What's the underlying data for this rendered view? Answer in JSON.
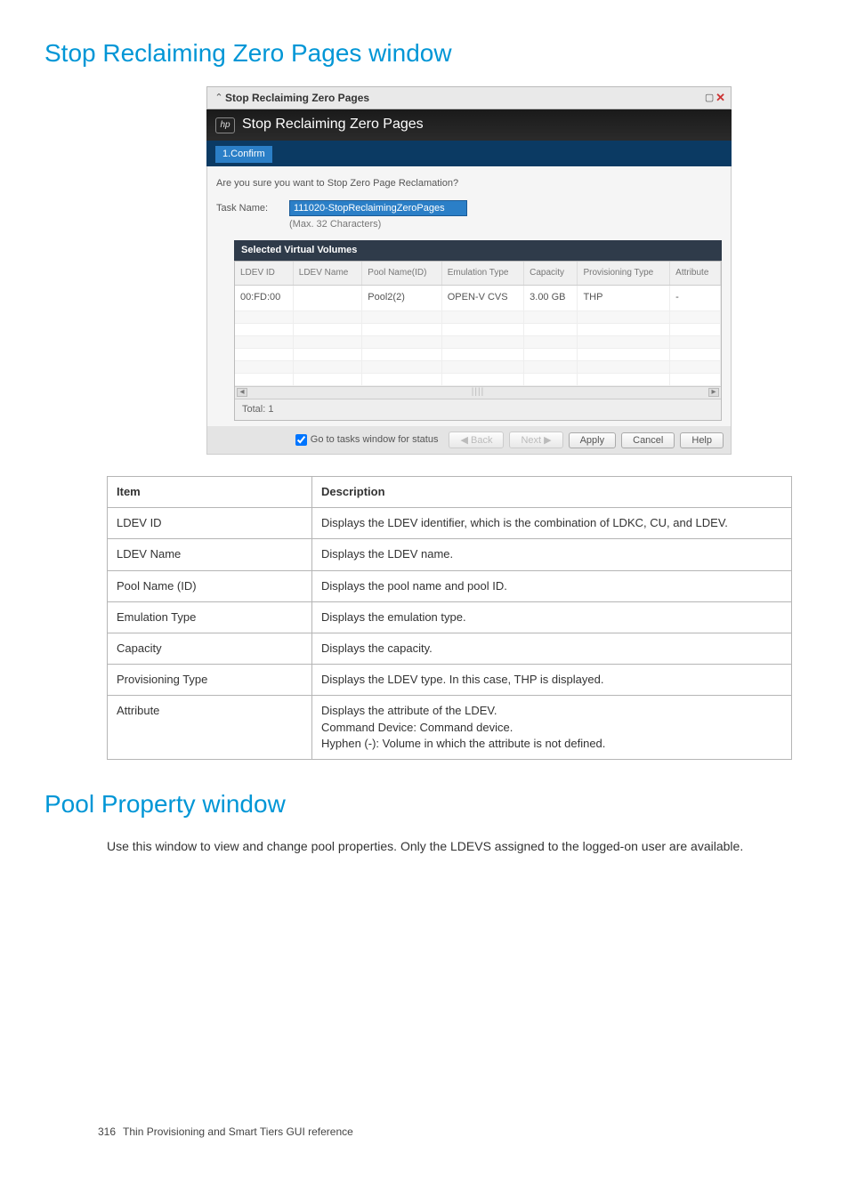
{
  "headings": {
    "main1": "Stop Reclaiming Zero Pages window",
    "main2": "Pool Property window"
  },
  "dialog": {
    "window_title": "Stop Reclaiming Zero Pages",
    "header_title": "Stop Reclaiming Zero Pages",
    "step_label": "1.Confirm",
    "confirm_question": "Are you sure you want to Stop Zero Page Reclamation?",
    "task_label": "Task Name:",
    "task_value": "111020-StopReclaimingZeroPages",
    "task_hint": "(Max. 32 Characters)",
    "panel_title": "Selected Virtual Volumes",
    "columns": {
      "ldev_id": "LDEV ID",
      "ldev_name": "LDEV Name",
      "pool": "Pool Name(ID)",
      "emulation": "Emulation Type",
      "capacity": "Capacity",
      "prov": "Provisioning Type",
      "attr": "Attribute"
    },
    "rows": [
      {
        "ldev_id": "00:FD:00",
        "ldev_name": "",
        "pool": "Pool2(2)",
        "emulation": "OPEN-V CVS",
        "capacity": "3.00 GB",
        "prov": "THP",
        "attr": "-"
      }
    ],
    "total_label": "Total: 1",
    "footer": {
      "checkbox": "Go to tasks window for status",
      "back": "◀ Back",
      "next": "Next ▶",
      "apply": "Apply",
      "cancel": "Cancel",
      "help": "Help"
    }
  },
  "desc_table": {
    "head_item": "Item",
    "head_desc": "Description",
    "rows": [
      {
        "item": "LDEV ID",
        "desc": "Displays the LDEV identifier, which is the combination of LDKC, CU, and LDEV."
      },
      {
        "item": "LDEV Name",
        "desc": "Displays the LDEV name."
      },
      {
        "item": "Pool Name (ID)",
        "desc": "Displays the pool name and pool ID."
      },
      {
        "item": "Emulation Type",
        "desc": "Displays the emulation type."
      },
      {
        "item": "Capacity",
        "desc": "Displays the capacity."
      },
      {
        "item": "Provisioning Type",
        "desc": "Displays the LDEV type. In this case, THP is displayed."
      },
      {
        "item": "Attribute",
        "desc": "Displays the attribute of the LDEV.\nCommand Device: Command device.\nHyphen (-): Volume in which the attribute is not defined."
      }
    ]
  },
  "pool_window_text": "Use this window to view and change pool properties. Only the LDEVS assigned to the logged-on user are available.",
  "footer": {
    "page": "316",
    "chapter": "Thin Provisioning and Smart Tiers GUI reference"
  }
}
